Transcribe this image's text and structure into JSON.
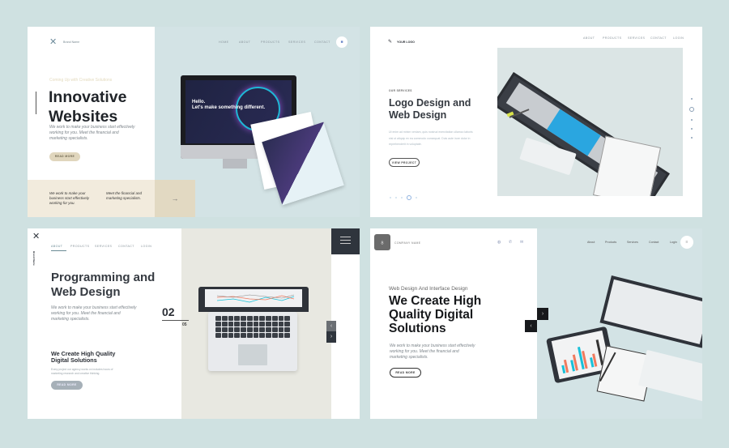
{
  "colors": {
    "background": "#cfe1e1",
    "panel_blue": "#d3e3e5",
    "beige": "#f2ebdd",
    "beige_dark": "#e2d9c2",
    "dark": "#2f353d",
    "accent_cyan": "#19c0d8",
    "accent_orange": "#f07a5e"
  },
  "panel1": {
    "brand": "Brand Name",
    "nav": [
      "HOME",
      "ABOUT",
      "PRODUCTS",
      "SERVICES",
      "CONTACT"
    ],
    "tagline": "Coming Up with Creative Solutions",
    "title_line1": "Innovative",
    "title_line2": "Websites",
    "description": "We work to make your business start effectively working for you. Meet the financial and marketing specialists.",
    "button": "READ MORE",
    "band_text1": "We work to make your business start effectively working for you.",
    "band_text2": "Meet the financial and marketing specialists.",
    "screen_line1": "Hello.",
    "screen_line2": "Let's make something different.",
    "menu_icon": "grid-icon",
    "arrow_icon": "arrow-right-icon"
  },
  "panel2": {
    "logo": "YOUR LOGO",
    "nav": [
      "ABOUT",
      "PRODUCTS",
      "SERVICES",
      "CONTACT",
      "LOGIN"
    ],
    "eyebrow": "OUR SERVICES",
    "title_line1": "Logo Design and",
    "title_line2": "Web Design",
    "description": "Ut enim ad minim veniam, quis nostrud exercitation ullamco laboris nisi ut aliquip ex ea commodo consequat. Duis aute irure dolor in reprehenderit in voluptate.",
    "button": "VIEW PROJECT",
    "pagination_active": 4,
    "pagination_total": 5,
    "side_dots_active": 2,
    "side_dots_total": 5
  },
  "panel3": {
    "brand": "Brand Name",
    "nav": [
      "ABOUT",
      "PRODUCTS",
      "SERVICES",
      "CONTACT",
      "LOGIN"
    ],
    "nav_active": "ABOUT",
    "title_line1": "Programming and",
    "title_line2": "Web Design",
    "description": "We work to make your business start effectively working for you. Meet the financial and marketing specialists.",
    "slide_current": "02",
    "slide_total": "05",
    "subtitle_line1": "We Create High Quality",
    "subtitle_line2": "Digital Solutions",
    "small_text": "Every project our agency works on includes hours of marketing research and creative thinking.",
    "button": "READ MORE",
    "menu_icon": "hamburger-icon"
  },
  "panel4": {
    "company": "COMPANY NAME",
    "contact_icons": [
      "globe-icon",
      "phone-icon",
      "mail-icon"
    ],
    "nav": [
      "About",
      "Products",
      "Services",
      "Contact",
      "Login"
    ],
    "eyebrow": "Web Design And Interface Design",
    "title_line1": "We Create High",
    "title_line2": "Quality Digital",
    "title_line3": "Solutions",
    "description": "We work to make your business start effectively working for you. Meet the financial and marketing specialists.",
    "button": "READ MORE",
    "next_label": "›",
    "prev_label": "‹"
  }
}
